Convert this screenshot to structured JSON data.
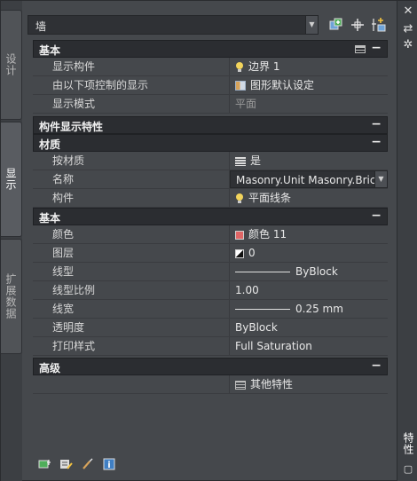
{
  "tabs": [
    {
      "label": "设计"
    },
    {
      "label": "显示"
    },
    {
      "label": "扩展数据"
    }
  ],
  "toolbar": {
    "object_type": "墙"
  },
  "sections": {
    "basic_top": {
      "title": "基本",
      "collapse": "−",
      "rows": [
        {
          "name": "显示构件",
          "value": "边界 1"
        },
        {
          "name": "由以下项控制的显示",
          "value": "图形默认设定"
        },
        {
          "name": "显示模式",
          "value": "平面"
        }
      ]
    },
    "component_display": {
      "title": "构件显示特性",
      "collapse": "−"
    },
    "material": {
      "title": "材质",
      "collapse": "−",
      "rows": [
        {
          "name": "按材质",
          "value": "是"
        },
        {
          "name": "名称",
          "value": "Masonry.Unit Masonry.Brick.Modula"
        },
        {
          "name": "构件",
          "value": "平面线条"
        }
      ]
    },
    "basic": {
      "title": "基本",
      "collapse": "−",
      "rows": [
        {
          "name": "颜色",
          "value": "颜色 11"
        },
        {
          "name": "图层",
          "value": "0"
        },
        {
          "name": "线型",
          "value": "ByBlock"
        },
        {
          "name": "线型比例",
          "value": "1.00"
        },
        {
          "name": "线宽",
          "value": "0.25 mm"
        },
        {
          "name": "透明度",
          "value": "ByBlock"
        },
        {
          "name": "打印样式",
          "value": "Full Saturation"
        }
      ]
    },
    "advanced": {
      "title": "高级",
      "collapse": "−",
      "rows": [
        {
          "name": "",
          "value": "其他特性"
        }
      ]
    }
  },
  "panel_title": "特性",
  "icons": {
    "bulb": "bulb-icon",
    "display": "display-props-icon",
    "material": "material-stack-icon",
    "color": "color-swatch-icon",
    "layer": "layer-icon",
    "more": "more-props-icon"
  },
  "colors": {
    "swatch_color_11": "#e06666",
    "category_bg": "#2b2d31",
    "panel_bg": "#45484c"
  }
}
